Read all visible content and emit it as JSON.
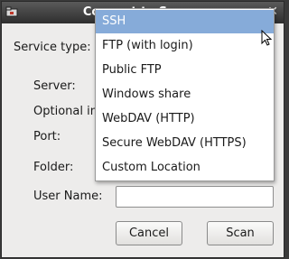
{
  "window": {
    "title": "Connect to Server",
    "close_glyph": "✕",
    "icon": "network-folder-icon"
  },
  "form": {
    "service_type_label": "Service type:",
    "server_label": "Server:",
    "optional_label": "Optional information:",
    "port_label": "Port:",
    "folder_label": "Folder:",
    "user_name_label": "User Name:",
    "user_name_value": ""
  },
  "buttons": {
    "cancel": "Cancel",
    "scan": "Scan"
  },
  "dropdown": {
    "selected": "SSH",
    "options": [
      "SSH",
      "FTP (with login)",
      "Public FTP",
      "Windows share",
      "WebDAV (HTTP)",
      "Secure WebDAV (HTTPS)",
      "Custom Location"
    ]
  },
  "colors": {
    "selection": "#86abd9",
    "titlebar": "#3c3c3c",
    "dialog_bg": "#edeceb"
  }
}
